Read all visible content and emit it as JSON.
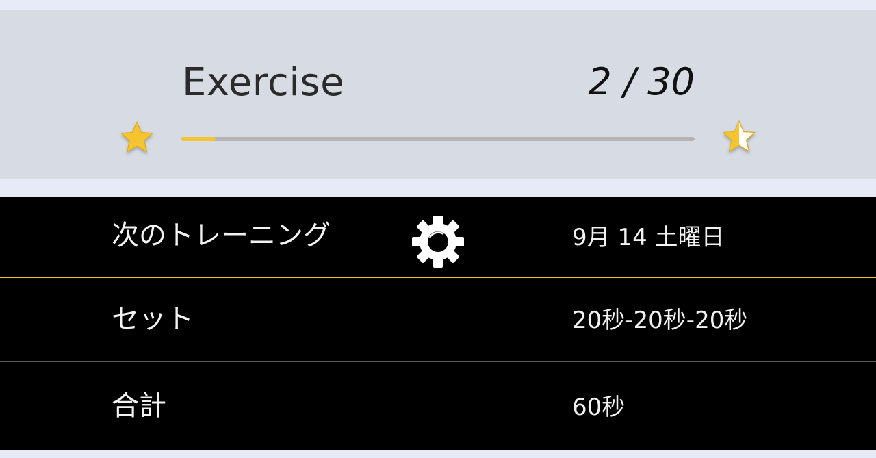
{
  "header": {
    "title": "Exercise",
    "counter": "2 / 30",
    "progress_fraction": 0.067,
    "start_icon": "star-full-icon",
    "goal_icon": "star-half-icon"
  },
  "colors": {
    "accent": "#f5c431",
    "panel_background": "#000000",
    "header_background": "#d7dbe3",
    "page_background": "#e6ebf7"
  },
  "schedule": {
    "next_training": {
      "label": "次のトレーニング",
      "value": "9月 14 土曜日",
      "settings_icon": "gear-icon"
    },
    "sets": {
      "label": "セット",
      "value": "20秒-20秒-20秒"
    },
    "total": {
      "label": "合計",
      "value": "60秒"
    }
  }
}
